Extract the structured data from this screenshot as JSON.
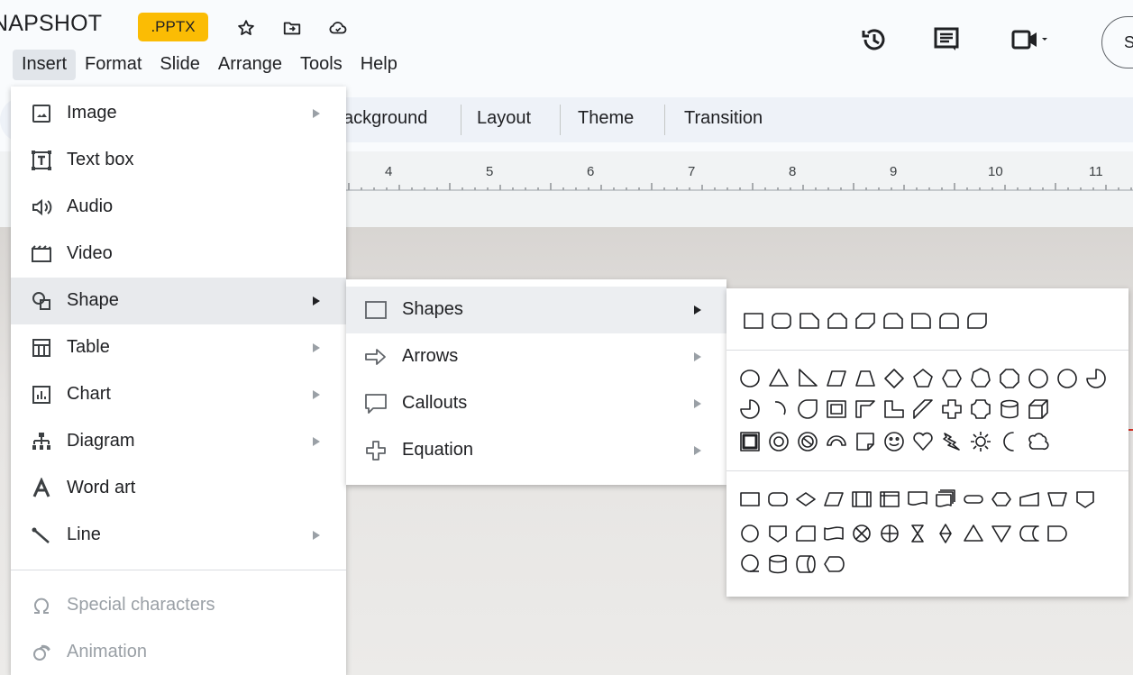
{
  "title_bar": {
    "doc_title": "NAPSHOT",
    "file_badge": ".PPTX",
    "share_label": "S"
  },
  "menubar": [
    "Insert",
    "Format",
    "Slide",
    "Arrange",
    "Tools",
    "Help"
  ],
  "toolbar": {
    "background_label": "ackground",
    "layout_label": "Layout",
    "theme_label": "Theme",
    "transition_label": "Transition"
  },
  "ruler": {
    "numbers": [
      "4",
      "5",
      "6",
      "7",
      "8",
      "9",
      "10",
      "11"
    ]
  },
  "insert_menu": {
    "items": [
      {
        "label": "Image",
        "icon": "image-icon",
        "submenu": true
      },
      {
        "label": "Text box",
        "icon": "text-box-icon",
        "submenu": false
      },
      {
        "label": "Audio",
        "icon": "audio-icon",
        "submenu": false
      },
      {
        "label": "Video",
        "icon": "video-icon",
        "submenu": false
      },
      {
        "label": "Shape",
        "icon": "shape-icon",
        "submenu": true,
        "active": true
      },
      {
        "label": "Table",
        "icon": "table-icon",
        "submenu": true
      },
      {
        "label": "Chart",
        "icon": "chart-icon",
        "submenu": true
      },
      {
        "label": "Diagram",
        "icon": "diagram-icon",
        "submenu": true
      },
      {
        "label": "Word art",
        "icon": "word-art-icon",
        "submenu": false
      },
      {
        "label": "Line",
        "icon": "line-icon",
        "submenu": true
      },
      {
        "label": "Special characters",
        "icon": "omega-icon",
        "submenu": false,
        "disabled": true
      },
      {
        "label": "Animation",
        "icon": "animation-icon",
        "submenu": false,
        "disabled": true
      }
    ]
  },
  "shape_submenu": {
    "items": [
      {
        "label": "Shapes",
        "icon": "rectangle-icon",
        "active": true
      },
      {
        "label": "Arrows",
        "icon": "arrow-icon"
      },
      {
        "label": "Callouts",
        "icon": "callout-icon"
      },
      {
        "label": "Equation",
        "icon": "plus-icon"
      }
    ]
  },
  "shapes_palette": {
    "groups": [
      "rectangles",
      "basic-shapes",
      "flowchart"
    ]
  },
  "colors": {
    "badge": "#fbbc04",
    "menu_hover": "#e8eaed",
    "toolbar_pill": "#eef2f8",
    "accent_red": "#d93025"
  }
}
